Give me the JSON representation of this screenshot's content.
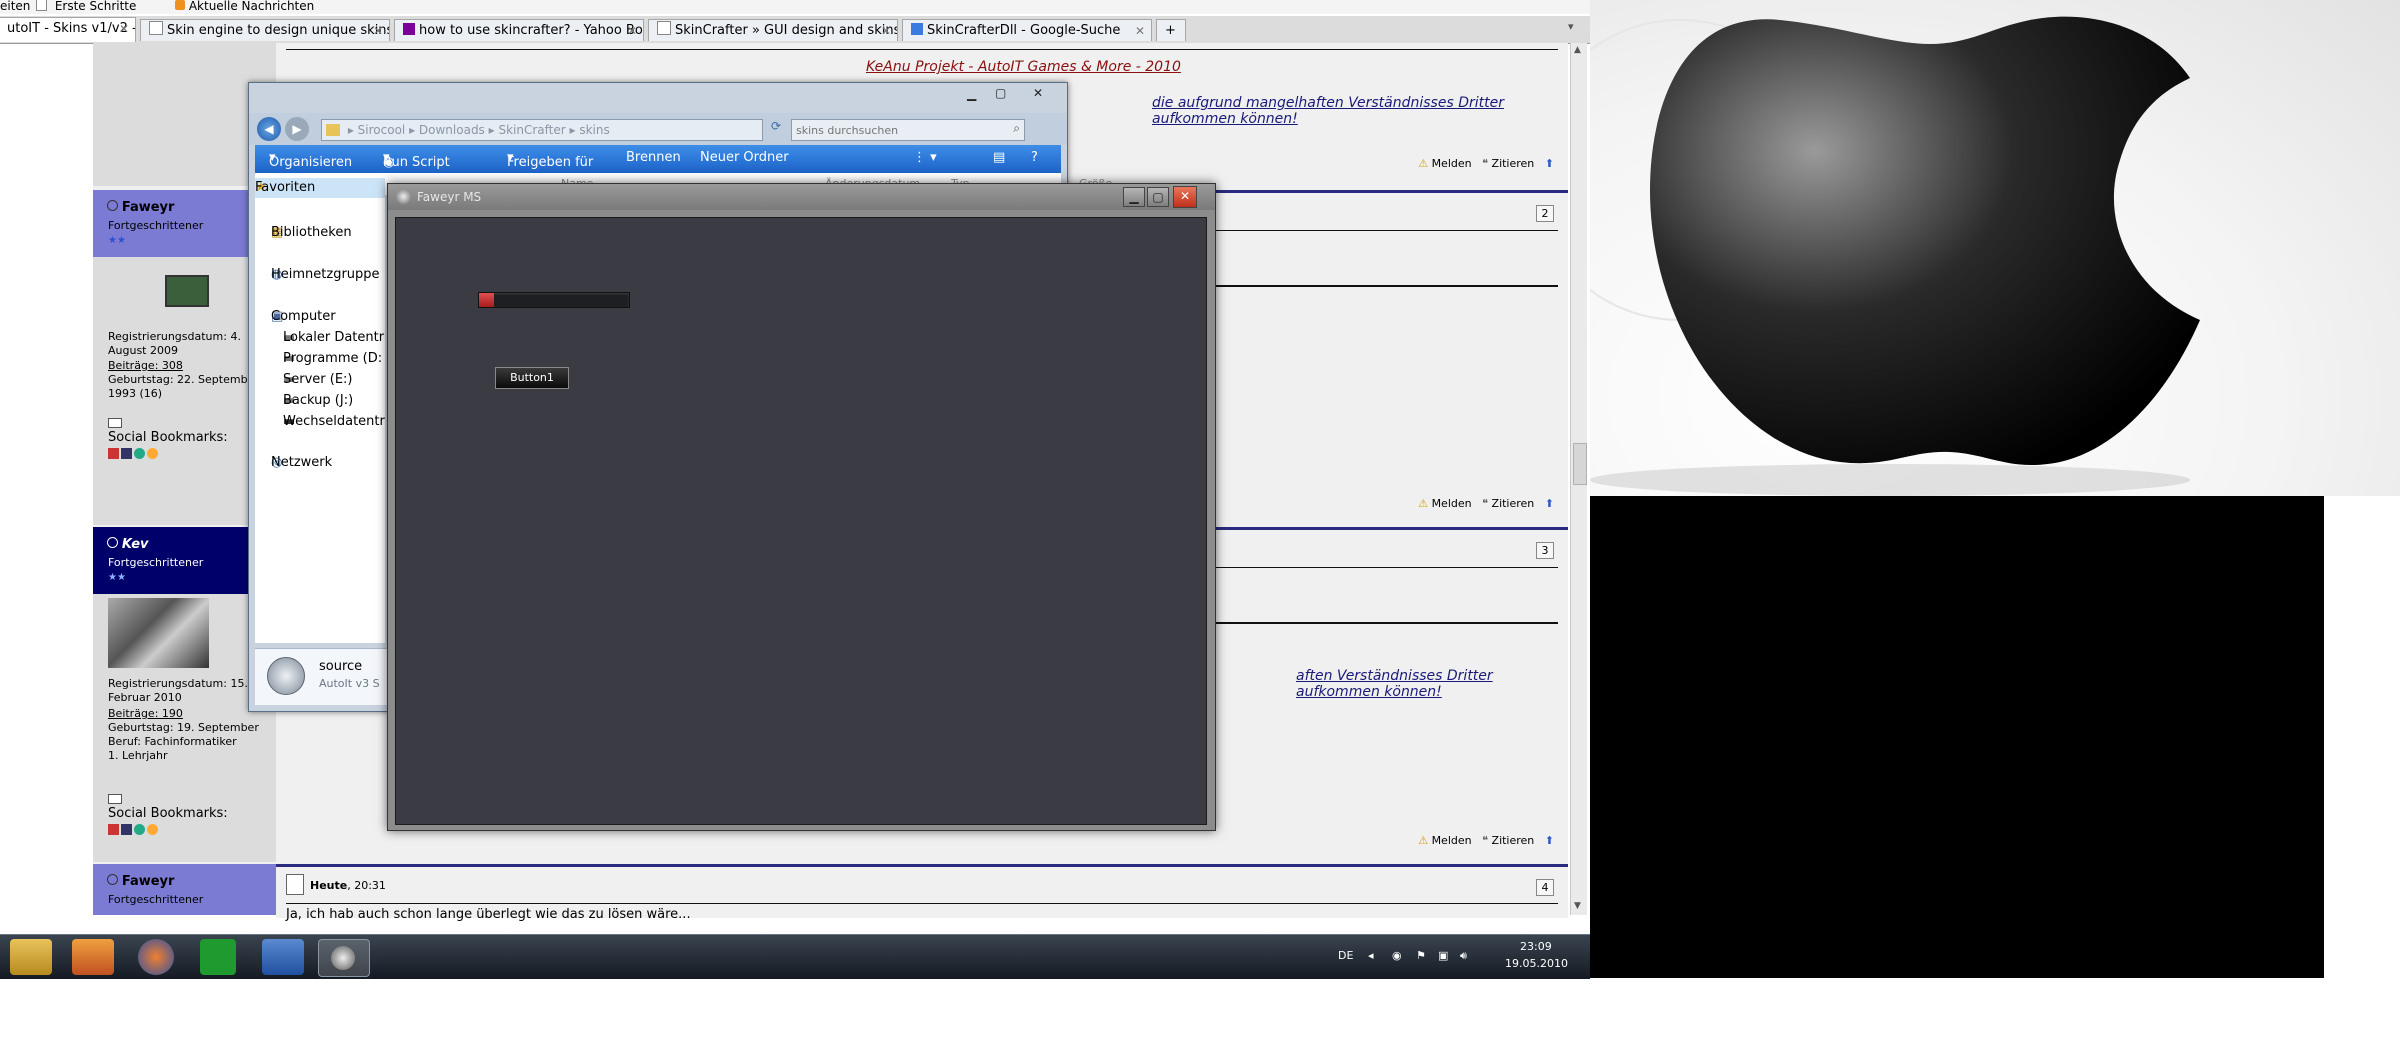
{
  "browser": {
    "bookmarks": [
      "eiten",
      "Erste Schritte",
      "Aktuelle Nachrichten"
    ],
    "tabs": [
      {
        "label": "utoIT - Skins v1/v2 - ...",
        "active": true
      },
      {
        "label": "Skin engine to design unique skins...",
        "active": false
      },
      {
        "label": "how to use skincrafter? - Yahoo Bo...",
        "active": false
      },
      {
        "label": "SkinCrafter » GUI design and skins...",
        "active": false
      },
      {
        "label": "SkinCrafterDll - Google-Suche",
        "active": false
      }
    ],
    "new_tab_label": "+"
  },
  "forum": {
    "top_links": {
      "project_link": "KeAnu Projekt - AutoIT Games & More - 2010",
      "signature_fragment": "die aufgrund mangelhaften Verständnisses Dritter aufkommen können!"
    },
    "actions": {
      "report": "Melden",
      "quote": "Zitieren"
    },
    "posts": [
      {
        "number": "2",
        "user": "Faweyr",
        "rank": "Fortgeschrittener",
        "registration": "Registrierungsdatum: 4. August 2009",
        "posts_label": "Beiträge: 308",
        "birthday": "Geburtstag: 22. September 1993 (16)",
        "bookmarks_label": "Social Bookmarks:"
      },
      {
        "number": "3",
        "user": "Kev",
        "rank": "Fortgeschrittener",
        "registration": "Registrierungsdatum: 15. Februar 2010",
        "posts_label": "Beiträge: 190",
        "birthday": "Geburtstag: 19. September",
        "job": "Beruf: Fachinformatiker 1. Lehrjahr",
        "bookmarks_label": "Social Bookmarks:",
        "signature_fragment": "aften Verständnisses Dritter aufkommen können!"
      },
      {
        "number": "4",
        "user": "Faweyr",
        "rank": "Fortgeschrittener",
        "date_prefix": "Heute",
        "time": ", 20:31",
        "text": "Ja, ich hab auch schon lange überlegt wie das zu lösen wäre..."
      }
    ]
  },
  "explorer": {
    "breadcrumb": [
      "Sirocool",
      "Downloads",
      "SkinCrafter",
      "skins"
    ],
    "search_placeholder": "skins durchsuchen",
    "toolbar": [
      "Organisieren",
      "Run Script",
      "Freigeben für",
      "Brennen",
      "Neuer Ordner"
    ],
    "columns": [
      "Name",
      "Änderungsdatum",
      "Typ",
      "Größe"
    ],
    "nav": {
      "favorites": "Favoriten",
      "libraries": "Bibliotheken",
      "homegroup": "Heimnetzgruppe",
      "computer": "Computer",
      "drives": [
        "Lokaler Datentr",
        "Programme (D:",
        "Server (E:)",
        "Backup (J:)",
        "Wechseldatentr"
      ],
      "network": "Netzwerk"
    },
    "details": {
      "name": "source",
      "type": "AutoIt v3 S"
    }
  },
  "app": {
    "title": "Faweyr MS",
    "button_label": "Button1",
    "progress_fraction": 0.1
  },
  "taskbar": {
    "language": "DE",
    "time": "23:09",
    "date": "19.05.2010"
  },
  "colors": {
    "userhead_blue": "#7b7bd4",
    "userhead_navy": "#00006b",
    "explorer_cmd": "#1c63c8",
    "app_client": "#3b3c43",
    "close_red": "#d6452b"
  }
}
